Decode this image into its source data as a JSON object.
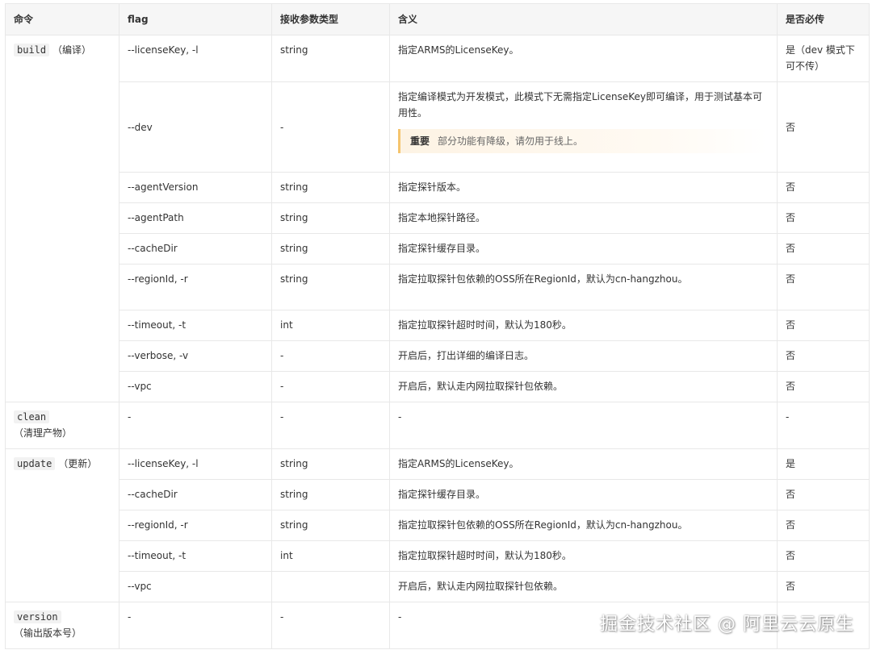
{
  "headers": [
    "命令",
    "flag",
    "接收参数类型",
    "含义",
    "是否必传"
  ],
  "build": {
    "cmd": "build",
    "suffix": "（编译）",
    "rows": [
      {
        "flag": "--licenseKey, -l",
        "type": "string",
        "desc": "指定ARMS的LicenseKey。",
        "req": "是（dev 模式下可不传）"
      },
      {
        "flag": "--dev",
        "type": "-",
        "desc": "指定编译模式为开发模式，此模式下无需指定LicenseKey即可编译，用于测试基本可用性。",
        "note_label": "重要",
        "note_text": "部分功能有降级，请勿用于线上。",
        "req": "否"
      },
      {
        "flag": "--agentVersion",
        "type": "string",
        "desc": "指定探针版本。",
        "req": "否"
      },
      {
        "flag": "--agentPath",
        "type": "string",
        "desc": "指定本地探针路径。",
        "req": "否"
      },
      {
        "flag": "--cacheDir",
        "type": "string",
        "desc": "指定探针缓存目录。",
        "req": "否"
      },
      {
        "flag": "--regionId, -r",
        "type": "string",
        "desc": "指定拉取探针包依赖的OSS所在RegionId，默认为cn-hangzhou。",
        "req": "否"
      },
      {
        "flag": "--timeout, -t",
        "type": "int",
        "desc": "指定拉取探针超时时间，默认为180秒。",
        "req": "否"
      },
      {
        "flag": "--verbose, -v",
        "type": "-",
        "desc": "开启后，打出详细的编译日志。",
        "req": "否"
      },
      {
        "flag": "--vpc",
        "type": "-",
        "desc": "开启后，默认走内网拉取探针包依赖。",
        "req": "否"
      }
    ]
  },
  "clean": {
    "cmd": "clean",
    "suffix": "（清理产物）",
    "flag": "-",
    "type": "-",
    "desc": "-",
    "req": "-"
  },
  "update": {
    "cmd": "update",
    "suffix": "（更新）",
    "rows": [
      {
        "flag": "--licenseKey, -l",
        "type": "string",
        "desc": "指定ARMS的LicenseKey。",
        "req": "是"
      },
      {
        "flag": "--cacheDir",
        "type": "string",
        "desc": "指定探针缓存目录。",
        "req": "否"
      },
      {
        "flag": "--regionId, -r",
        "type": "string",
        "desc": "指定拉取探针包依赖的OSS所在RegionId，默认为cn-hangzhou。",
        "req": "否"
      },
      {
        "flag": "--timeout, -t",
        "type": "int",
        "desc": "指定拉取探针超时时间，默认为180秒。",
        "req": "否"
      },
      {
        "flag": "--vpc",
        "type": "",
        "desc": "开启后，默认走内网拉取探针包依赖。",
        "req": "否"
      }
    ]
  },
  "version": {
    "cmd": "version",
    "suffix": "（输出版本号）",
    "flag": "-",
    "type": "-",
    "desc": "-",
    "req": ""
  },
  "watermark": "掘金技术社区 @ 阿里云云原生"
}
